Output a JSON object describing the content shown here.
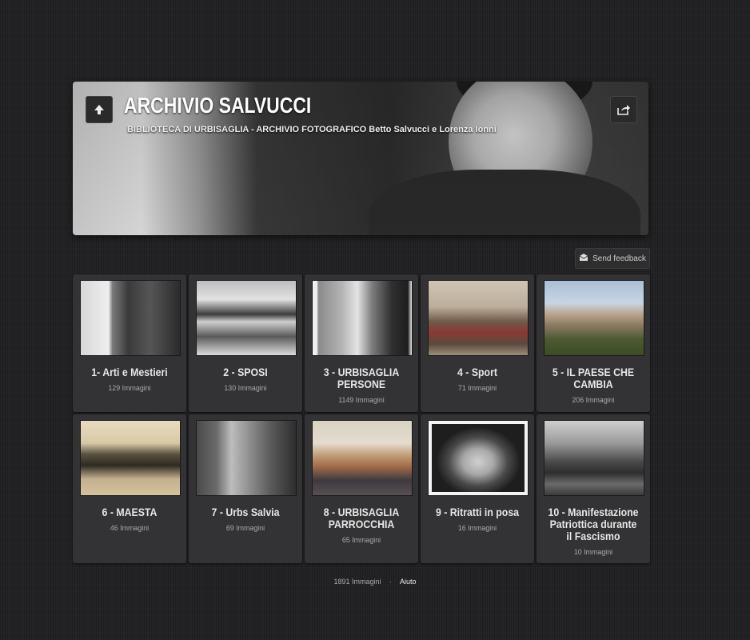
{
  "header": {
    "title": "ARCHIVIO SALVUCCI",
    "subtitle": "BIBLIOTECA DI URBISAGLIA - ARCHIVIO FOTOGRAFICO Betto Salvucci e Lorenza Ionni",
    "up_icon": "arrow-up-icon",
    "share_icon": "share-icon"
  },
  "feedback": {
    "label": "Send feedback",
    "icon": "feedback-icon"
  },
  "galleries": [
    {
      "title": "1- Arti e Mestieri",
      "count": "129 Immagini"
    },
    {
      "title": "2 - SPOSI",
      "count": "130 Immagini"
    },
    {
      "title": "3 - URBISAGLIA PERSONE",
      "count": "1149 Immagini"
    },
    {
      "title": "4 - Sport",
      "count": "71 Immagini"
    },
    {
      "title": "5 - IL PAESE CHE CAMBIA",
      "count": "206 Immagini"
    },
    {
      "title": "6 - MAESTA",
      "count": "46 Immagini"
    },
    {
      "title": "7 - Urbs Salvia",
      "count": "69 Immagini"
    },
    {
      "title": "8 - URBISAGLIA PARROCCHIA",
      "count": "65 Immagini"
    },
    {
      "title": "9 - Ritratti in posa",
      "count": "16 Immagini"
    },
    {
      "title": "10 - Manifestazione Patriottica durante il Fascismo",
      "count": "10 Immagini"
    }
  ],
  "footer": {
    "total": "1891 Immagini",
    "separator": "·",
    "help": "Aiuto"
  }
}
